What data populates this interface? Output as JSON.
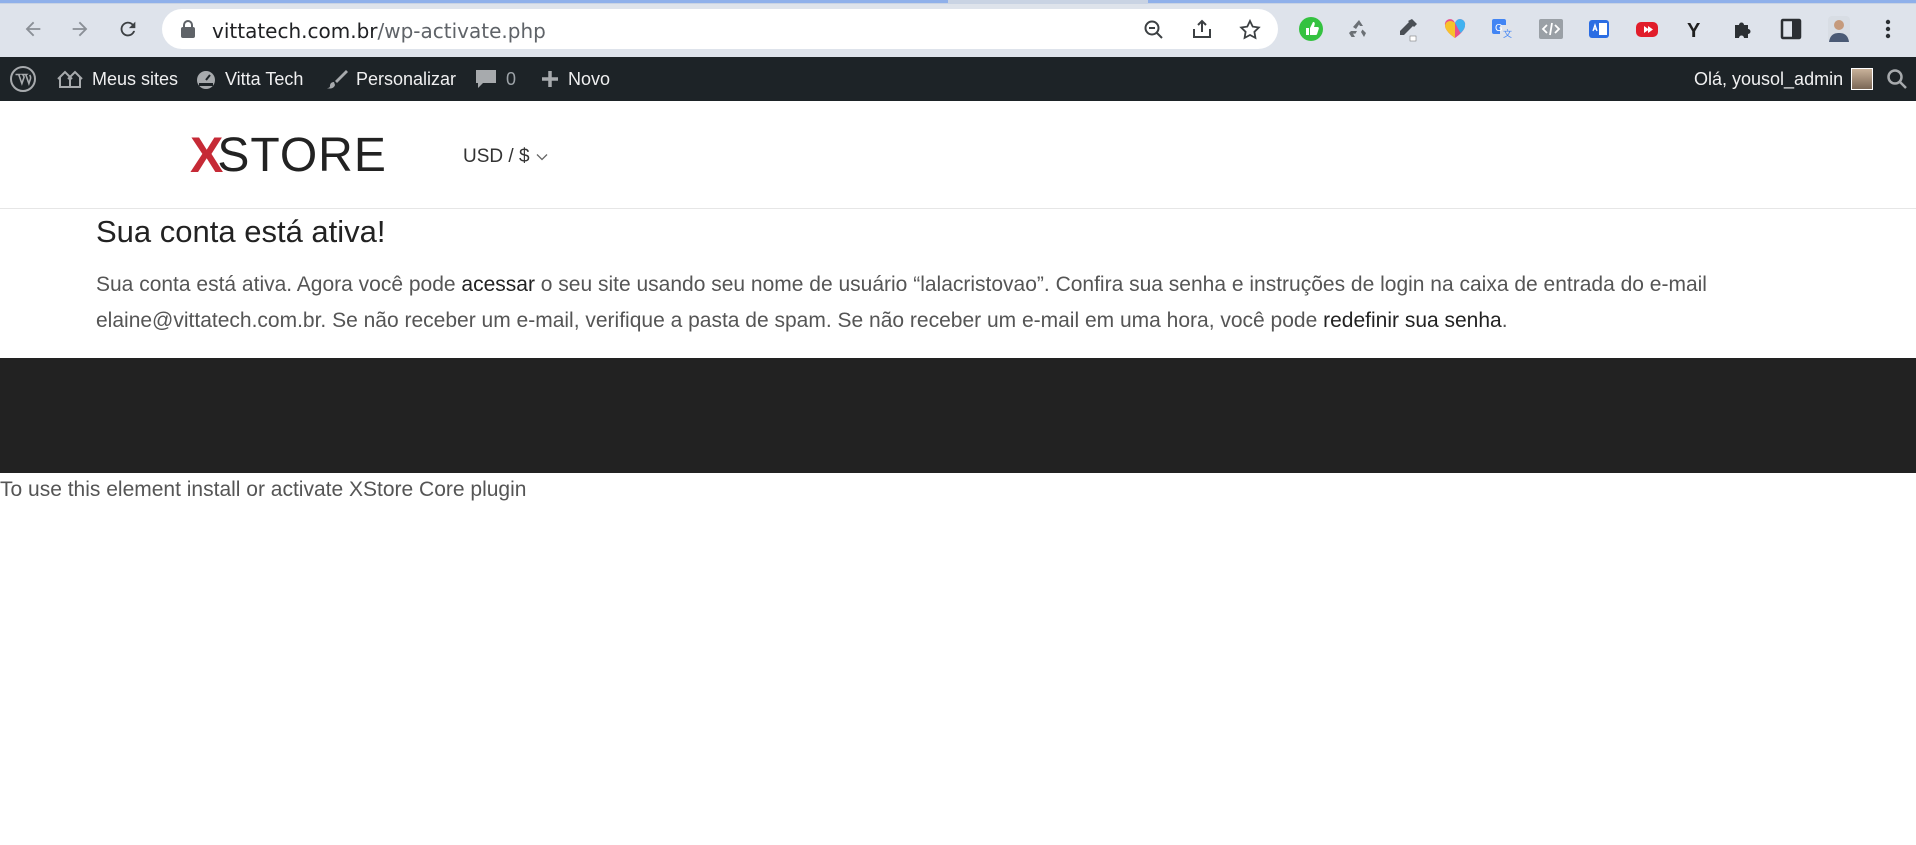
{
  "browser": {
    "url_host": "vittatech.com.br",
    "url_path": "/wp-activate.php",
    "extensions": [
      "green-thumb-icon",
      "recycle-icon",
      "eyedropper-icon",
      "heart-icon",
      "translate-icon",
      "code-icon",
      "translate-alt-icon",
      "youtube-icon",
      "y-icon",
      "puzzle-icon",
      "sidepanel-icon",
      "profile-avatar"
    ]
  },
  "adminbar": {
    "my_sites": "Meus sites",
    "site_name": "Vitta Tech",
    "customize": "Personalizar",
    "comments_count": "0",
    "new": "Novo",
    "greeting": "Olá, yousol_admin"
  },
  "header": {
    "logo_x": "X",
    "logo_text": "STORE",
    "currency": "USD / $"
  },
  "content": {
    "title": "Sua conta está ativa!",
    "p1_a": "Sua conta está ativa. Agora você pode ",
    "link_login": "acessar",
    "p1_b": " o seu site usando seu nome de usuário “lalacristovao”. Confira sua senha e instruções de login na caixa de entrada do e-mail elaine@vittatech.com.br. Se não receber um e-mail, verifique a pasta de spam. Se não receber um e-mail em uma hora, você pode ",
    "link_reset": "redefinir sua senha",
    "p1_c": "."
  },
  "plugin_note": "To use this element install or activate XStore Core plugin",
  "colors": {
    "adminbar_bg": "#1d2327",
    "footer_bg": "#222222",
    "logo_accent": "#c62a36"
  }
}
